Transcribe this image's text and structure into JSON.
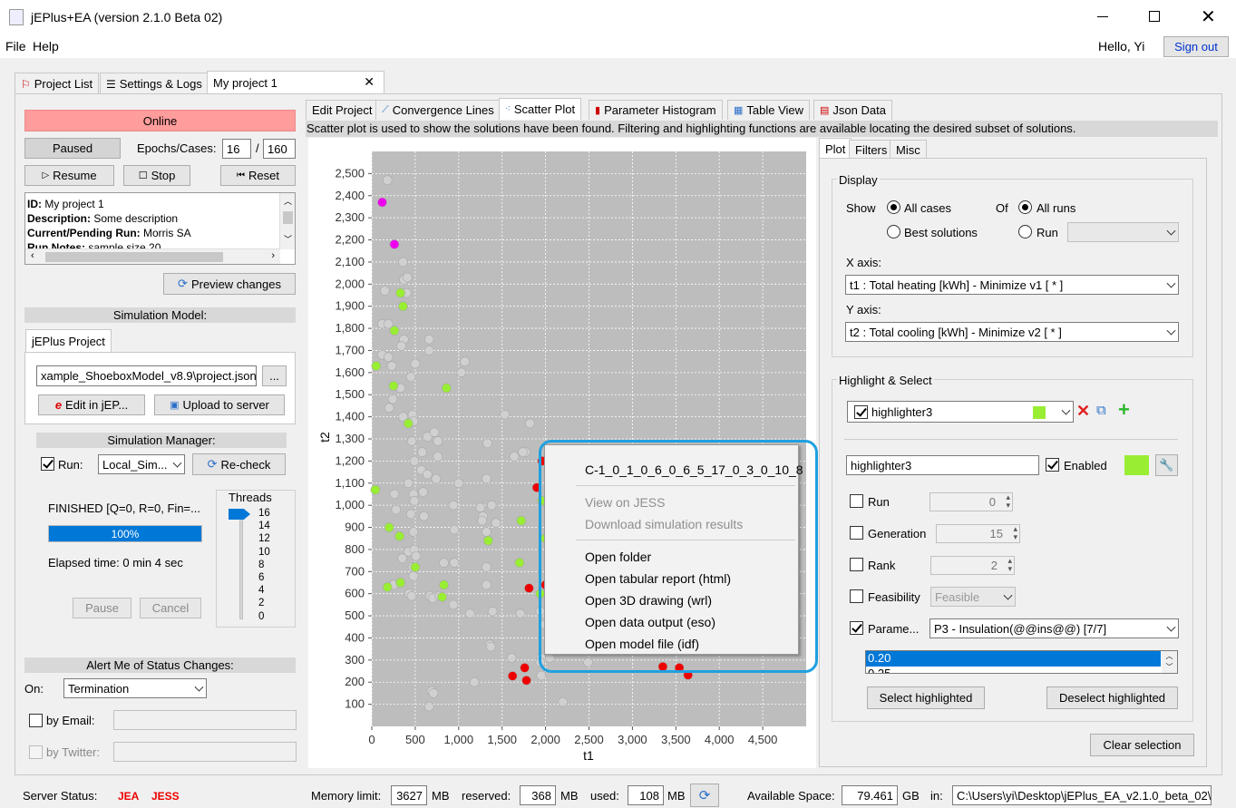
{
  "window": {
    "title": "jEPlus+EA (version 2.1.0 Beta 02)"
  },
  "menubar": {
    "file": "File",
    "help": "Help"
  },
  "user": {
    "greeting": "Hello, Yi",
    "signout": "Sign out"
  },
  "main_tabs": [
    "Project List",
    "Settings & Logs",
    "My project 1"
  ],
  "left": {
    "status": "Online",
    "paused": "Paused",
    "epochs_label": "Epochs/Cases:",
    "epochs_value": "16",
    "epochs_sep": "/",
    "cases_value": "160",
    "resume": "Resume",
    "stop": "Stop",
    "reset": "Reset",
    "info": {
      "id_label": "ID:",
      "id_value": " My project 1",
      "desc_label": "Description:",
      "desc_value": " Some description",
      "run_label": "Current/Pending Run:",
      "run_value": " Morris SA",
      "notes_label": "Run Notes:",
      "notes_value": " sample size 20"
    },
    "preview": "Preview changes",
    "sim_model_title": "Simulation Model:",
    "jeplus_tab": "jEPlus Project",
    "project_path": "xample_ShoeboxModel_v8.9\\project.json",
    "browse": "...",
    "edit_jep": "Edit in jEP...",
    "upload": "Upload to server",
    "sim_manager_title": "Simulation Manager:",
    "run_label": "Run:",
    "run_value": "Local_Sim...",
    "recheck": "Re-check",
    "finished": "FINISHED [Q=0, R=0, Fin=...",
    "progress_text": "100%",
    "progress_value": 1.0,
    "elapsed": "Elapsed time: 0 min 4 sec",
    "pause": "Pause",
    "cancel": "Cancel",
    "threads_title": "Threads",
    "threads_ticks": [
      "16",
      "14",
      "12",
      "10",
      "8",
      "6",
      "4",
      "2",
      "0"
    ],
    "threads_value": 16,
    "alert_title": "Alert Me of Status Changes:",
    "on_label": "On:",
    "on_value": "Termination",
    "by_email": "by Email:",
    "by_twitter": "by Twitter:"
  },
  "subtabs": [
    "Edit Project",
    "Convergence Lines",
    "Scatter Plot",
    "Parameter Histogram",
    "Table View",
    "Json Data"
  ],
  "description": "Scatter plot is used to show the solutions have been found. Filtering and highlighting functions are available locating the desired subset of solutions.",
  "chart_data": {
    "type": "scatter",
    "xlabel": "t1",
    "ylabel": "t2",
    "xlim": [
      0,
      5000
    ],
    "ylim": [
      0,
      2600
    ],
    "xticks": [
      "0",
      "500",
      "1,000",
      "1,500",
      "2,000",
      "2,500",
      "3,000",
      "3,500",
      "4,000",
      "4,500"
    ],
    "yticks": [
      "100",
      "200",
      "300",
      "400",
      "500",
      "600",
      "700",
      "800",
      "900",
      "1,000",
      "1,100",
      "1,200",
      "1,300",
      "1,400",
      "1,500",
      "1,600",
      "1,700",
      "1,800",
      "1,900",
      "2,000",
      "2,100",
      "2,200",
      "2,300",
      "2,400",
      "2,500"
    ],
    "colors": {
      "gray": "#d0d0d0",
      "green": "#99ee33",
      "red": "#ee0000",
      "magenta": "#ee00ee",
      "background": "#bdbdbd"
    },
    "series": [
      {
        "color": "magenta",
        "points": [
          [
            120,
            2370
          ],
          [
            260,
            2180
          ]
        ]
      },
      {
        "color": "red",
        "points": [
          [
            1960,
            1200
          ],
          [
            2490,
            1205
          ],
          [
            2050,
            1140
          ],
          [
            1900,
            1080
          ],
          [
            2000,
            640
          ],
          [
            1810,
            625
          ],
          [
            1620,
            228
          ],
          [
            1760,
            265
          ],
          [
            1780,
            208
          ],
          [
            3350,
            270
          ],
          [
            3540,
            265
          ],
          [
            3640,
            232
          ]
        ]
      },
      {
        "color": "green",
        "points": [
          [
            330,
            1960
          ],
          [
            360,
            1900
          ],
          [
            260,
            1790
          ],
          [
            50,
            1630
          ],
          [
            250,
            1540
          ],
          [
            860,
            1530
          ],
          [
            420,
            1370
          ],
          [
            40,
            1070
          ],
          [
            200,
            900
          ],
          [
            320,
            860
          ],
          [
            500,
            720
          ],
          [
            330,
            650
          ],
          [
            180,
            630
          ],
          [
            830,
            640
          ],
          [
            810,
            585
          ],
          [
            1340,
            840
          ],
          [
            1720,
            930
          ],
          [
            1700,
            740
          ],
          [
            1960,
            1020
          ],
          [
            2030,
            1000
          ],
          [
            2000,
            850
          ],
          [
            1940,
            600
          ]
        ]
      },
      {
        "color": "gray",
        "points": [
          [
            180,
            2470
          ],
          [
            360,
            2100
          ],
          [
            370,
            2020
          ],
          [
            410,
            2030
          ],
          [
            150,
            1970
          ],
          [
            400,
            1960
          ],
          [
            120,
            1820
          ],
          [
            190,
            1820
          ],
          [
            370,
            1750
          ],
          [
            660,
            1750
          ],
          [
            660,
            1700
          ],
          [
            340,
            1720
          ],
          [
            120,
            1680
          ],
          [
            190,
            1670
          ],
          [
            230,
            1630
          ],
          [
            500,
            1640
          ],
          [
            1070,
            1650
          ],
          [
            1030,
            1600
          ],
          [
            450,
            1580
          ],
          [
            330,
            1530
          ],
          [
            240,
            1480
          ],
          [
            200,
            1440
          ],
          [
            360,
            1400
          ],
          [
            470,
            1410
          ],
          [
            480,
            1380
          ],
          [
            1530,
            1410
          ],
          [
            640,
            1310
          ],
          [
            460,
            1290
          ],
          [
            720,
            1330
          ],
          [
            760,
            1290
          ],
          [
            1820,
            1370
          ],
          [
            1330,
            1280
          ],
          [
            490,
            1200
          ],
          [
            580,
            1240
          ],
          [
            760,
            1220
          ],
          [
            1640,
            1220
          ],
          [
            1770,
            1240
          ],
          [
            1740,
            1240
          ],
          [
            570,
            1160
          ],
          [
            640,
            1140
          ],
          [
            740,
            1120
          ],
          [
            1000,
            1100
          ],
          [
            1320,
            1120
          ],
          [
            420,
            1100
          ],
          [
            260,
            1050
          ],
          [
            480,
            1050
          ],
          [
            590,
            1060
          ],
          [
            940,
            1000
          ],
          [
            1250,
            990
          ],
          [
            1380,
            1000
          ],
          [
            280,
            980
          ],
          [
            490,
            1020
          ],
          [
            450,
            960
          ],
          [
            600,
            950
          ],
          [
            1280,
            950
          ],
          [
            1430,
            920
          ],
          [
            1320,
            880
          ],
          [
            480,
            880
          ],
          [
            950,
            890
          ],
          [
            1270,
            930
          ],
          [
            420,
            790
          ],
          [
            490,
            800
          ],
          [
            510,
            770
          ],
          [
            350,
            760
          ],
          [
            830,
            740
          ],
          [
            950,
            740
          ],
          [
            470,
            720
          ],
          [
            480,
            680
          ],
          [
            1320,
            720
          ],
          [
            1320,
            640
          ],
          [
            250,
            640
          ],
          [
            430,
            600
          ],
          [
            460,
            590
          ],
          [
            670,
            590
          ],
          [
            700,
            580
          ],
          [
            780,
            590
          ],
          [
            940,
            550
          ],
          [
            1130,
            510
          ],
          [
            1390,
            520
          ],
          [
            1710,
            510
          ],
          [
            1940,
            520
          ],
          [
            1990,
            460
          ],
          [
            1360,
            370
          ],
          [
            1370,
            360
          ],
          [
            1610,
            310
          ],
          [
            1950,
            310
          ],
          [
            2050,
            310
          ],
          [
            1940,
            290
          ],
          [
            2490,
            290
          ],
          [
            1180,
            200
          ],
          [
            1950,
            230
          ],
          [
            690,
            160
          ],
          [
            710,
            150
          ],
          [
            2200,
            110
          ],
          [
            660,
            90
          ]
        ]
      }
    ]
  },
  "context_menu": {
    "header": "C-1_0_1_0_6_0_6_5_17_0_3_0_10_8",
    "items_disabled": [
      "View on JESS",
      "Download simulation results"
    ],
    "items": [
      "Open folder",
      "Open tabular report (html)",
      "Open 3D drawing (wrl)",
      "Open data output (eso)",
      "Open model file (idf)"
    ]
  },
  "right": {
    "tabs": [
      "Plot",
      "Filters",
      "Misc"
    ],
    "display_title": "Display",
    "show_label": "Show",
    "all_cases": "All cases",
    "best_solutions": "Best solutions",
    "of_label": "Of",
    "all_runs": "All runs",
    "run_label": "Run",
    "x_axis_label": "X axis:",
    "x_axis_value": "t1 : Total heating [kWh] - Minimize v1 [ * ]",
    "y_axis_label": "Y axis:",
    "y_axis_value": "t2 : Total cooling [kWh] - Minimize v2 [ * ]",
    "highlight_title": "Highlight & Select",
    "highlighter_combo": "highlighter3",
    "highlighter_color": "#99ee33",
    "highlighter_name": "highlighter3",
    "enabled": "Enabled",
    "run": "Run",
    "run_value": "0",
    "generation": "Generation",
    "generation_value": "15",
    "rank": "Rank",
    "rank_value": "2",
    "feasibility": "Feasibility",
    "feasibility_value": "Feasible",
    "parameter": "Parame...",
    "parameter_value": "P3 - Insulation(@@ins@@) [7/7]",
    "param_list": [
      "0.20",
      "0.25"
    ],
    "select_highlighted": "Select highlighted",
    "deselect_highlighted": "Deselect highlighted",
    "clear_selection": "Clear selection"
  },
  "statusbar": {
    "server_status": "Server Status:",
    "jea": "JEA",
    "jess": "JESS",
    "memory_limit": "Memory limit:",
    "memory_limit_value": "3627",
    "mb1": "MB",
    "reserved": "reserved:",
    "reserved_value": "368",
    "mb2": "MB",
    "used": "used:",
    "used_value": "108",
    "mb3": "MB",
    "available": "Available Space:",
    "available_value": "79.461",
    "gb": "GB",
    "in": "in:",
    "path": "C:\\Users\\yi\\Desktop\\jEPlus_EA_v2.1.0_beta_02\\."
  }
}
